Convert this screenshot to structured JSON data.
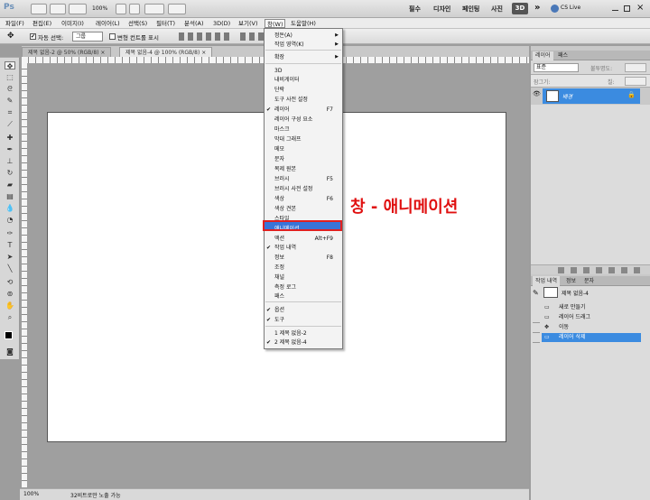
{
  "app": {
    "logo": "Ps",
    "zoom": "100%",
    "workspaces": [
      "필수",
      "디자인",
      "페인팅",
      "사진"
    ],
    "ws3d": "3D",
    "more": "»",
    "cslive": "CS Live"
  },
  "menubar": {
    "items": [
      "파일(F)",
      "편집(E)",
      "이미지(I)",
      "레이어(L)",
      "선택(S)",
      "필터(T)",
      "분석(A)",
      "3D(D)",
      "보기(V)",
      "창(W)",
      "도움말(H)"
    ]
  },
  "options": {
    "auto_select": "자동 선택:",
    "auto_select_value": "그룹",
    "transform": "변형 컨트롤 표시"
  },
  "doc_tabs": [
    {
      "label": "제목 없음-2 @ 50% (RGB/8)",
      "close": "×"
    },
    {
      "label": "제목 없음-4 @ 100% (RGB/8)",
      "close": "×"
    }
  ],
  "window_menu": {
    "items": [
      {
        "label": "정돈(A)",
        "arrow": "▶"
      },
      {
        "label": "작업 영역(K)",
        "arrow": "▶"
      },
      {
        "label": "확장",
        "arrow": "▶"
      },
      {
        "label": "3D"
      },
      {
        "label": "내비게이터"
      },
      {
        "label": "단락"
      },
      {
        "label": "도구 사전 설정"
      },
      {
        "label": "레이어",
        "shortcut": "F7",
        "check": "✔"
      },
      {
        "label": "레이어 구성 요소"
      },
      {
        "label": "마스크"
      },
      {
        "label": "막대 그래프"
      },
      {
        "label": "메모"
      },
      {
        "label": "문자"
      },
      {
        "label": "복제 원본"
      },
      {
        "label": "브러시",
        "shortcut": "F5"
      },
      {
        "label": "브러시 사전 설정"
      },
      {
        "label": "색상",
        "shortcut": "F6"
      },
      {
        "label": "색상 견본"
      },
      {
        "label": "스타일"
      },
      {
        "label": "애니메이션"
      },
      {
        "label": "액션",
        "shortcut": "Alt+F9"
      },
      {
        "label": "작업 내역",
        "check": "✔"
      },
      {
        "label": "정보",
        "shortcut": "F8"
      },
      {
        "label": "조정"
      },
      {
        "label": "채널"
      },
      {
        "label": "측정 로그"
      },
      {
        "label": "패스"
      },
      {
        "label": "옵션",
        "check": "✔"
      },
      {
        "label": "도구",
        "check": "✔"
      },
      {
        "label": "1 제목 없음-2"
      },
      {
        "label": "2 제목 없음-4",
        "check": "✔"
      }
    ]
  },
  "annotation": "창 - 애니메이션",
  "layers_panel": {
    "tabs": [
      "레이어",
      "패스"
    ],
    "blend": "표준",
    "opacity": "불투명도:",
    "fill": "칠:",
    "lock": "잠그기:",
    "layer_name": "배경"
  },
  "history_panel": {
    "tabs": [
      "작업 내역",
      "정보",
      "문자"
    ],
    "snapshot": "제목 없음-4",
    "items": [
      "새로 만들기",
      "레이어 드래그",
      "이동",
      "레이어 삭제"
    ]
  },
  "status": {
    "zoom": "100%",
    "info": "32비트로만 노출 가능"
  }
}
